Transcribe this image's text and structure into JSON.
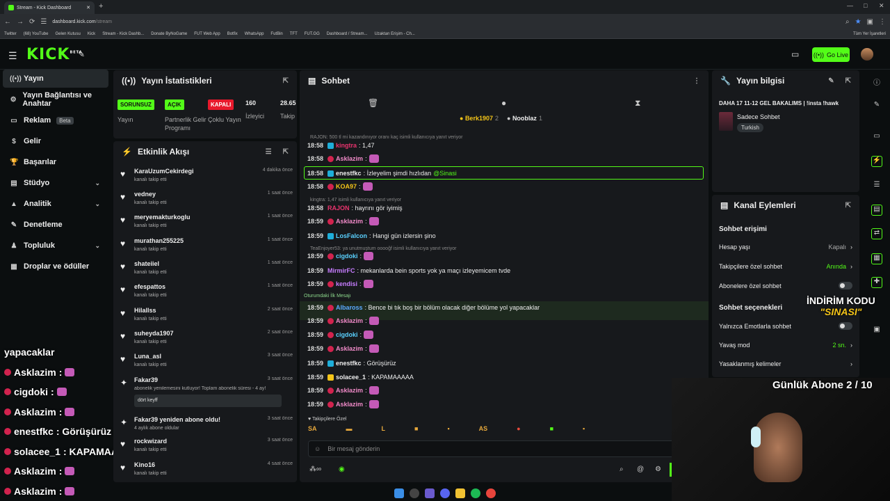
{
  "browser": {
    "tab_title": "Stream - Kick Dashboard",
    "url": "dashboard.kick.com",
    "url_path": "/stream",
    "bookmarks": [
      "Twitter",
      "(68) YouTube",
      "Gelen Kutusu",
      "Kick",
      "Stream - Kick Dashb...",
      "Donate ByNoGame",
      "FUT Web App",
      "Botfix",
      "WhatsApp",
      "FutBin",
      "TFT",
      "FUT.GG",
      "Dashboard / Stream...",
      "Uzaktan Erişim - Ch..."
    ],
    "bookmarks_all": "Tüm Yer İşaretleri"
  },
  "topbar": {
    "logo": "KICK",
    "logo_sup": "BETA",
    "go_live": "Go Live"
  },
  "sidebar": {
    "items": [
      {
        "label": "Yayın",
        "icon": "broadcast-icon"
      },
      {
        "label": "Yayın Bağlantısı ve Anahtar",
        "icon": "link-icon"
      },
      {
        "label": "Reklam",
        "icon": "ad-icon",
        "badge": "Beta"
      },
      {
        "label": "Gelir",
        "icon": "dollar-icon"
      },
      {
        "label": "Başarılar",
        "icon": "trophy-icon"
      },
      {
        "label": "Stüdyo",
        "icon": "studio-icon"
      },
      {
        "label": "Analitik",
        "icon": "chart-icon"
      },
      {
        "label": "Denetleme",
        "icon": "hammer-icon"
      },
      {
        "label": "Topluluk",
        "icon": "community-icon"
      },
      {
        "label": "Droplar ve ödüller",
        "icon": "gift-icon"
      }
    ]
  },
  "stats": {
    "title": "Yayın İstatistikleri",
    "cells": [
      {
        "badge": "SORUNSUZ",
        "caption": "Yayın",
        "color": "#53fc18"
      },
      {
        "badge": "AÇIK",
        "caption": "Partnerlik Gelir Programı",
        "color": "#53fc18"
      },
      {
        "badge": "KAPALI",
        "caption": "Çoklu Yayın",
        "color": "#e8192c"
      },
      {
        "value": "160",
        "caption": "İzleyici"
      },
      {
        "value": "28.65",
        "caption": "Takip"
      }
    ]
  },
  "activity": {
    "title": "Etkinlik Akışı",
    "items": [
      {
        "name": "KaraUzumCekirdegi",
        "sub": "kanalı takip etti",
        "time": "4 dakika önce"
      },
      {
        "name": "vedney",
        "sub": "kanalı takip etti",
        "time": "1 saat önce"
      },
      {
        "name": "meryemakturkoglu",
        "sub": "kanalı takip etti",
        "time": "1 saat önce"
      },
      {
        "name": "murathan255225",
        "sub": "kanalı takip etti",
        "time": "1 saat önce"
      },
      {
        "name": "shateiiel",
        "sub": "kanalı takip etti",
        "time": "1 saat önce"
      },
      {
        "name": "efespattos",
        "sub": "kanalı takip etti",
        "time": "1 saat önce"
      },
      {
        "name": "Hilallss",
        "sub": "kanalı takip etti",
        "time": "2 saat önce"
      },
      {
        "name": "suheyda1907",
        "sub": "kanalı takip etti",
        "time": "2 saat önce"
      },
      {
        "name": "Luna_asl",
        "sub": "kanalı takip etti",
        "time": "3 saat önce"
      },
      {
        "name": "Fakar39",
        "sub": "abonelik yenilemesini kutluyor! Toplam abonelik süresi - 4 ay!",
        "time": "3 saat önce",
        "msg": "dört keyff"
      },
      {
        "name": "Fakar39 yeniden abone oldu!",
        "sub": "4 aylık abone oldular",
        "time": "3 saat önce"
      },
      {
        "name": "rockwizard",
        "sub": "kanalı takip etti",
        "time": "3 saat önce"
      },
      {
        "name": "Kino16",
        "sub": "kanalı takip etti",
        "time": "4 saat önce"
      }
    ]
  },
  "chat": {
    "title": "Sohbet",
    "leaders": [
      {
        "name": "Berk1907",
        "count": "2"
      },
      {
        "name": "Nooblaz",
        "count": "1"
      }
    ],
    "lines": [
      {
        "type": "reply",
        "text": "RAJON: 500 tl mi kazandınıyor oranı kaç isimli kullanıcıya yanıt veriyor"
      },
      {
        "time": "18:58",
        "user": "kingtra",
        "color": "#e8336d",
        "badge": "b",
        "msg": ": 1,47"
      },
      {
        "time": "18:58",
        "user": "Asklazim",
        "color": "#f08ac8",
        "badge": "r",
        "msg": ":",
        "emote": true
      },
      {
        "time": "18:58",
        "user": "enestfkc",
        "color": "#eeeeee",
        "badge": "b",
        "msg": ": İzleyelim şimdi hızlıdan ",
        "mention": "@Sinasi",
        "highlight": true
      },
      {
        "time": "18:58",
        "user": "KOA97",
        "color": "#f5c518",
        "badge": "r",
        "msg": ":",
        "emote": true
      },
      {
        "type": "reply",
        "text": "kingtra: 1,47 isimli kullanıcıya yanıt veriyor"
      },
      {
        "time": "18:58",
        "user": "RAJON",
        "color": "#e8336d",
        "badge": "",
        "msg": ": hayrını gör iyimiş"
      },
      {
        "time": "18:59",
        "user": "Asklazim",
        "color": "#f08ac8",
        "badge": "r",
        "msg": ":",
        "emote": true
      },
      {
        "time": "18:59",
        "user": "LosFalcon",
        "color": "#5ad1ff",
        "badge": "b",
        "msg": ": Hangi gün izlersin şino"
      },
      {
        "type": "reply",
        "text": "TeaEnjoyer53: ya unutmuştum ooooğf isimli kullanıcıya yanıt veriyor"
      },
      {
        "time": "18:59",
        "user": "cigdoki",
        "color": "#5ad1ff",
        "badge": "r",
        "msg": ":",
        "emote": true
      },
      {
        "time": "18:59",
        "user": "MirmirFC",
        "color": "#c77dff",
        "badge": "",
        "msg": ": mekanlarda bein sports yok ya maçı izleyemicem tvde"
      },
      {
        "time": "18:59",
        "user": "kendisi",
        "color": "#c77dff",
        "badge": "r",
        "msg": ":",
        "emote": true
      },
      {
        "type": "firstmsg",
        "text": "Oturumdaki İlk Mesajı"
      },
      {
        "time": "18:59",
        "user": "Albaross",
        "color": "#5aa9ff",
        "badge": "r",
        "msg": ": Bence bi tık boş bir bölüm olacak diğer bölüme yol yapacaklar",
        "first": true
      },
      {
        "time": "18:59",
        "user": "Asklazim",
        "color": "#f08ac8",
        "badge": "r",
        "msg": ":",
        "emote": true
      },
      {
        "time": "18:59",
        "user": "cigdoki",
        "color": "#5ad1ff",
        "badge": "r",
        "msg": ":",
        "emote": true
      },
      {
        "time": "18:59",
        "user": "Asklazim",
        "color": "#f08ac8",
        "badge": "r",
        "msg": ":",
        "emote": true
      },
      {
        "time": "18:59",
        "user": "enestfkc",
        "color": "#eeeeee",
        "badge": "b",
        "msg": ": Görüşürüz"
      },
      {
        "time": "18:59",
        "user": "solacee_1",
        "color": "#eeeeee",
        "badge": "y",
        "msg": ": KAPAMAAAAA"
      },
      {
        "time": "18:59",
        "user": "Asklazim",
        "color": "#f08ac8",
        "badge": "r",
        "msg": ":",
        "emote": true
      },
      {
        "time": "18:59",
        "user": "Asklazim",
        "color": "#f08ac8",
        "badge": "r",
        "msg": ":",
        "emote": true
      }
    ],
    "followers_only": "Takipçilere Özel",
    "input_placeholder": "Bir mesaj gönderin"
  },
  "info": {
    "title": "Yayın bilgisi",
    "stream_title": "DAHA 17 11-12 GEL BAKALIMS | !insta !hawk",
    "category": "Sadece Sohbet",
    "tag": "Turkish"
  },
  "channel": {
    "title": "Kanal Eylemleri",
    "access_heading": "Sohbet erişimi",
    "access": [
      {
        "label": "Hesap yaşı",
        "value": "Kapalı"
      },
      {
        "label": "Takipçilere özel sohbet",
        "value": "Anında",
        "value_color": "#53fc18"
      },
      {
        "label": "Abonelere özel sohbet",
        "toggle": true
      }
    ],
    "options_heading": "Sohbet seçenekleri",
    "options": [
      {
        "label": "Yalnızca Emotlarla sohbet",
        "toggle": true
      },
      {
        "label": "Yavaş mod",
        "value": "2 sn.",
        "value_color": "#53fc18"
      },
      {
        "label": "Yasaklanmış kelimeler",
        "value": ""
      }
    ]
  },
  "overlay": {
    "discount_line1": "İNDİRİM KODU",
    "discount_line2": "\"SINASI\"",
    "daily_subs": "Günlük Abone 2 / 10",
    "chat": [
      {
        "user": "yapacaklar",
        "msg": ""
      },
      {
        "user": "Asklazim",
        "msg": ":",
        "emote": true
      },
      {
        "user": "cigdoki",
        "msg": ":",
        "emote": true
      },
      {
        "user": "Asklazim",
        "msg": ":",
        "emote": true
      },
      {
        "user": "enestfkc",
        "msg": ": Görüşürüz"
      },
      {
        "user": "solacee_1",
        "msg": ": KAPAMAAAAA"
      },
      {
        "user": "Asklazim",
        "msg": ":",
        "emote": true
      },
      {
        "user": "Asklazim",
        "msg": ":",
        "emote": true
      }
    ]
  }
}
